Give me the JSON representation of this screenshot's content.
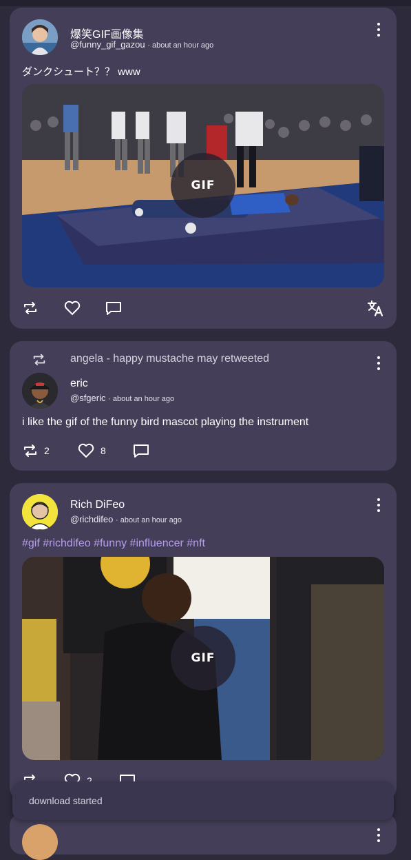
{
  "posts": [
    {
      "display_name": "爆笑GIF画像集",
      "handle": "@funny_gif_gazou",
      "time": "about an hour ago",
      "text": "ダンクシュート？？ www",
      "media_badge": "GIF",
      "actions": [
        "retweet-icon",
        "heart-icon",
        "reply-icon",
        "translate-icon"
      ]
    },
    {
      "retweeted_by": "angela - happy mustache may retweeted",
      "display_name": "eric",
      "handle": "@sfgeric",
      "time": "about an hour ago",
      "text": "i like the gif of the funny bird mascot playing the instrument",
      "retweet_count": "2",
      "like_count": "8",
      "actions": [
        "retweet-icon",
        "heart-icon",
        "reply-icon"
      ]
    },
    {
      "display_name": "Rich DiFeo",
      "handle": "@richdifeo",
      "time": "about an hour ago",
      "tags": "#gif #richdifeo #funny #influencer #nft",
      "media_badge": "GIF",
      "like_count": "2",
      "actions": [
        "retweet-icon",
        "heart-icon",
        "reply-icon"
      ]
    }
  ],
  "toast": {
    "message": "download started"
  },
  "colors": {
    "background": "#2c2a3b",
    "card": "#443e58",
    "hashtag": "#b89cf0"
  }
}
